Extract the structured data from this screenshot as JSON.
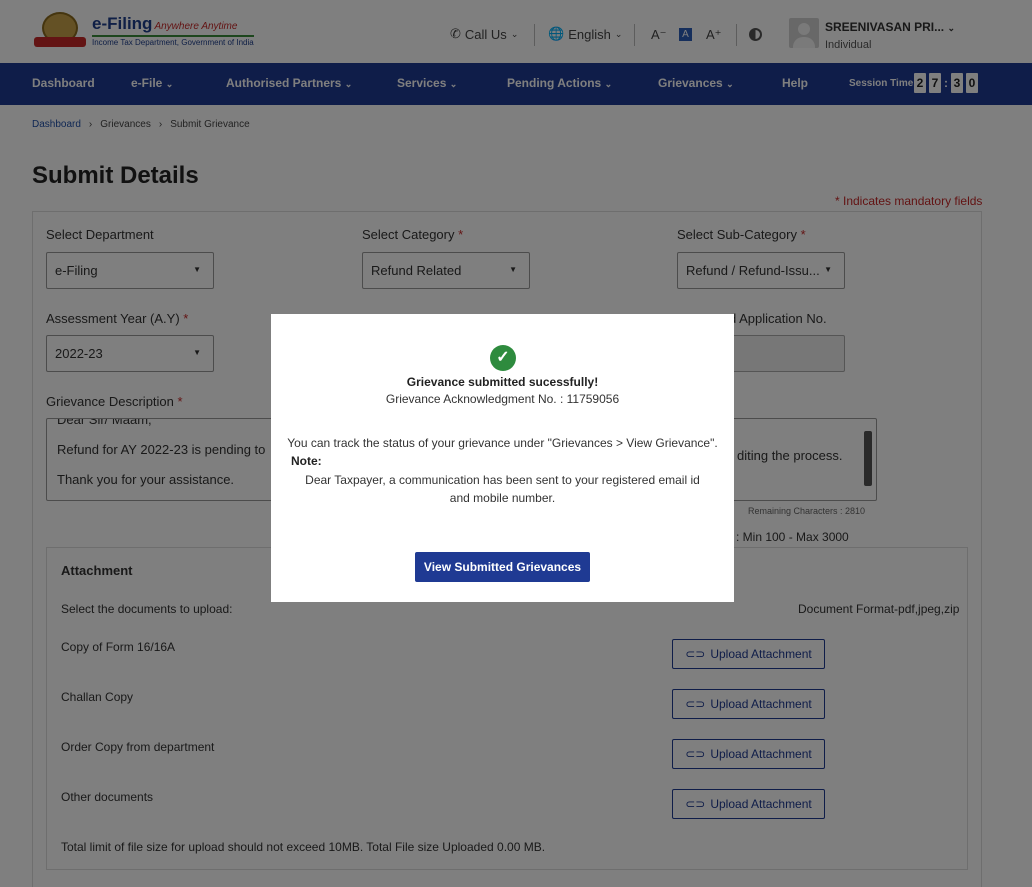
{
  "header": {
    "logo_title": "e-Filing",
    "logo_tagline": "Anywhere Anytime",
    "logo_subtitle": "Income Tax Department, Government of India",
    "call_us": "Call Us",
    "language": "English",
    "font_decrease": "A⁻",
    "font_normal": "A",
    "font_increase": "A⁺",
    "user_name": "SREENIVASAN PRI...",
    "user_role": "Individual"
  },
  "nav": {
    "items": [
      "Dashboard",
      "e-File",
      "Authorised Partners",
      "Services",
      "Pending Actions",
      "Grievances",
      "Help"
    ],
    "session_label": "Session Time",
    "session_digits": [
      "2",
      "7",
      "3",
      "0"
    ]
  },
  "breadcrumb": [
    "Dashboard",
    "Grievances",
    "Submit Grievance"
  ],
  "page_title": "Submit Details",
  "mandatory_note": "* Indicates mandatory fields",
  "form": {
    "department_label": "Select Department",
    "department_value": "e-Filing",
    "category_label": "Select Category",
    "category_value": "Refund Related",
    "subcategory_label": "Select Sub-Category",
    "subcategory_value": "Refund / Refund-Issu...",
    "ay_label": "Assessment Year (A.Y)",
    "ay_value": "2022-23",
    "app_no_label": "d Application No.",
    "required_mark": "*",
    "desc_label": "Grievance Description",
    "desc_lines": [
      "Dear Sir/ Maam,",
      "Refund for AY 2022-23 is pending to",
      "Thank you for your assistance."
    ],
    "desc_right": "diting the process.",
    "remaining": "Remaining Characters : 2810",
    "char_limit": "r Limit : Min 100 - Max 3000"
  },
  "attachments": {
    "title": "Attachment",
    "select_text": "Select the documents to upload:",
    "format_text": "Document Format-pdf,jpeg,zip",
    "docs": [
      "Copy of Form 16/16A",
      "Challan Copy",
      "Order Copy from department",
      "Other documents"
    ],
    "upload_label": "Upload Attachment",
    "footer": "Total limit of file size for upload should not exceed 10MB. Total File size Uploaded 0.00 MB."
  },
  "modal": {
    "title": "Grievance submitted sucessfully!",
    "ack": "Grievance Acknowledgment No. : 11759056",
    "track": "You can track the status of your grievance under \"Grievances > View Grievance\".",
    "note_label": "Note:",
    "note_text": "Dear Taxpayer, a communication has been sent to your registered email id and mobile number.",
    "button": "View Submitted Grievances"
  },
  "icons": {
    "check": "check-circle-icon",
    "phone": "phone-icon",
    "globe": "globe-icon",
    "contrast": "contrast-icon",
    "paperclip": "paperclip-icon"
  },
  "colors": {
    "nav_bg": "#1f3a93",
    "required": "#c62828",
    "success": "#2e8b3e"
  }
}
